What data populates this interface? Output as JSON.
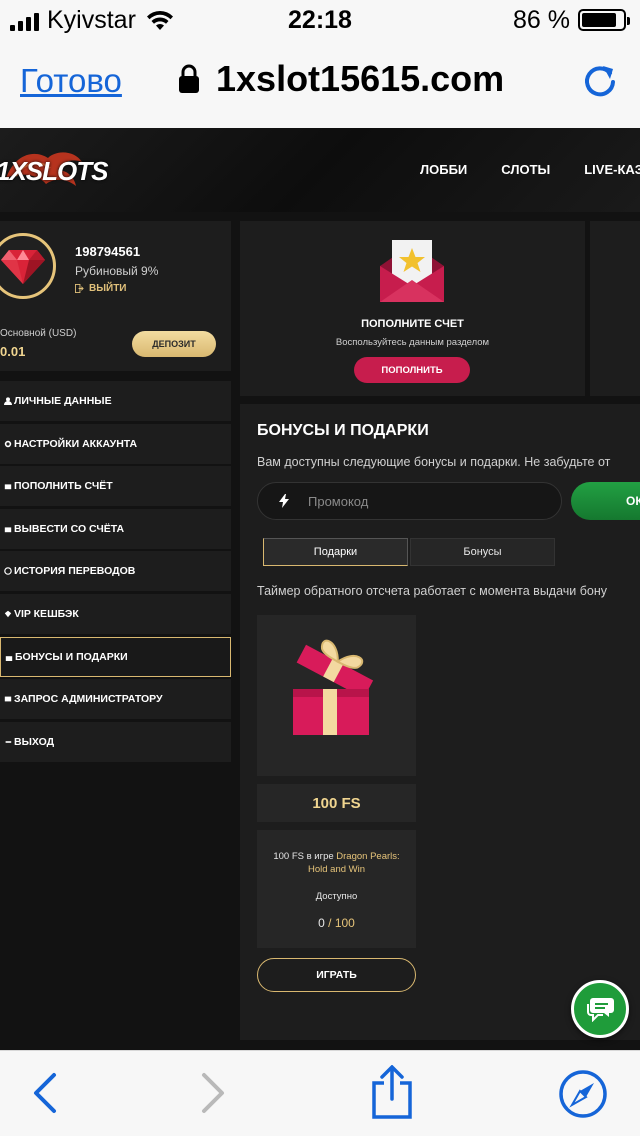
{
  "status_bar": {
    "carrier": "Kyivstar",
    "time": "22:18",
    "battery_percent": "86 %",
    "battery_level": 0.86
  },
  "browser": {
    "done_label": "Готово",
    "domain": "1xslot15615.com"
  },
  "site": {
    "logo_text": "1XSLOTS",
    "nav": [
      "ЛОББИ",
      "СЛОТЫ",
      "LIVE-КАЗИНО"
    ]
  },
  "profile": {
    "user_id": "198794561",
    "level": "Рубиновый 9%",
    "logout_label": "ВЫЙТИ",
    "balance_label": "Основной (USD)",
    "balance_value": "0.01",
    "deposit_label": "ДЕПОЗИТ"
  },
  "side_menu": {
    "items": [
      {
        "label": "ЛИЧНЫЕ ДАННЫЕ",
        "icon": "user-icon"
      },
      {
        "label": "НАСТРОЙКИ АККАУНТА",
        "icon": "settings-icon"
      },
      {
        "label": "ПОПОЛНИТЬ СЧЁТ",
        "icon": "deposit-icon"
      },
      {
        "label": "ВЫВЕСТИ СО СЧЁТА",
        "icon": "withdraw-icon"
      },
      {
        "label": "ИСТОРИЯ ПЕРЕВОДОВ",
        "icon": "history-icon"
      },
      {
        "label": "VIP КЕШБЭК",
        "icon": "vip-icon"
      },
      {
        "label": "БОНУСЫ И ПОДАРКИ",
        "icon": "gift-icon"
      },
      {
        "label": "ЗАПРОС АДМИНИСТРАТОРУ",
        "icon": "support-icon"
      },
      {
        "label": "ВЫХОД",
        "icon": "exit-icon"
      }
    ],
    "active_index": 6
  },
  "promo": {
    "title": "ПОПОЛНИТЕ СЧЕТ",
    "subtitle": "Воспользуйтесь данным разделом",
    "button_label": "ПОПОЛНИТЬ"
  },
  "bonuses": {
    "heading": "БОНУСЫ И ПОДАРКИ",
    "description": "Вам доступны следующие бонусы и подарки. Не забудьте от",
    "promo_placeholder": "Промокод",
    "ok_label": "ОК",
    "tabs": [
      "Подарки",
      "Бонусы"
    ],
    "active_tab": 0,
    "timer_note": "Таймер обратного отсчета работает с момента выдачи бону",
    "gift": {
      "badge": "100 FS",
      "game_prefix": "100 FS в игре",
      "game_name": "Dragon Pearls: Hold and Win",
      "availability_label": "Доступно",
      "used": "0",
      "separator": " / ",
      "total": "100",
      "play_label": "ИГРАТЬ"
    }
  },
  "colors": {
    "accent_gold": "#d9b870",
    "cta_red": "#c71d4d",
    "ok_green": "#1f9c3a",
    "ios_blue": "#1565d8"
  }
}
